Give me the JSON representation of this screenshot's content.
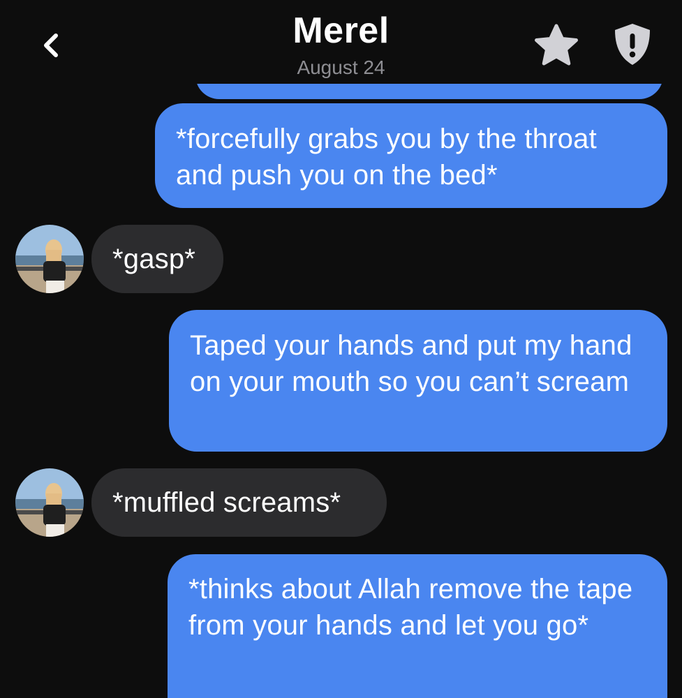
{
  "header": {
    "title": "Merel",
    "subtitle": "August 24",
    "back_icon": "chevron-left-icon",
    "favorite_icon": "star-icon",
    "safety_icon": "shield-alert-icon"
  },
  "colors": {
    "background": "#0d0d0d",
    "outgoing_bubble": "#4a86f0",
    "incoming_bubble": "#2c2c2e",
    "subtitle": "#8e8e93",
    "icon": "#d1d1d6"
  },
  "messages": [
    {
      "direction": "outgoing",
      "text": "*forcefully grabs you by the throat and push you on the bed*"
    },
    {
      "direction": "incoming",
      "text": "*gasp*"
    },
    {
      "direction": "outgoing",
      "text": "Taped your hands and put my hand on your mouth so you can’t scream"
    },
    {
      "direction": "incoming",
      "text": "*muffled screams*"
    },
    {
      "direction": "outgoing",
      "text": "*thinks about Allah remove the tape from your hands and let you go*"
    }
  ]
}
